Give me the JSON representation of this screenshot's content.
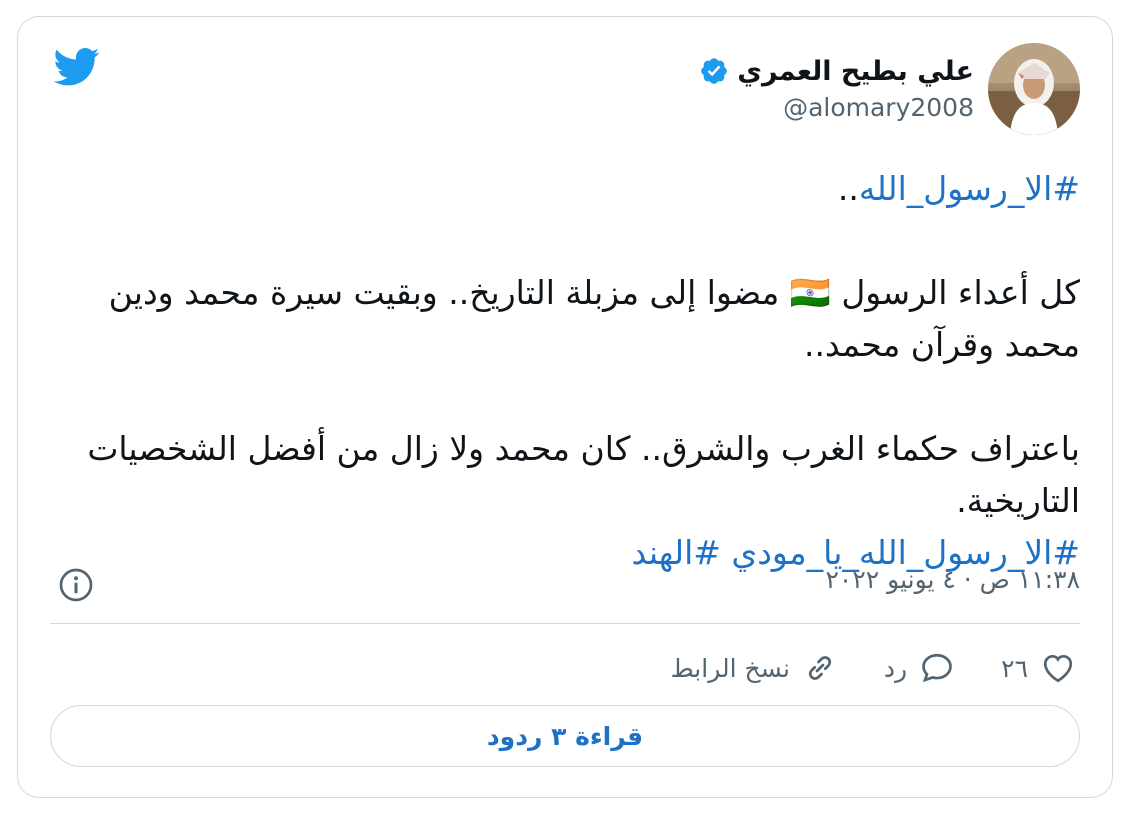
{
  "author": {
    "name": "علي بطيح العمري",
    "handle": "@alomary2008",
    "verified": true
  },
  "tweet": {
    "hashtag_line": "#الا_رسول_الله",
    "hashtag_line_suffix": "..",
    "paragraph_1": "كل أعداء الرسول 🇮🇳 مضوا إلى مزبلة التاريخ.. وبقيت سيرة محمد ودين محمد وقرآن محمد..",
    "paragraph_2": "باعتراف حكماء الغرب والشرق.. كان محمد ولا زال من أفضل الشخصيات التاريخية.",
    "hashtag_1": "#الا_رسول_الله_يا_مودي",
    "hashtag_2": "#الهند"
  },
  "timestamp": "١١:٣٨ ص · ٤ يونيو ٢٠٢٢",
  "actions": {
    "like_count": "٢٦",
    "reply_label": "رد",
    "copy_link_label": "نسخ الرابط"
  },
  "replies_button_label": "قراءة ٣ ردود",
  "colors": {
    "accent": "#1d72c6",
    "twitter_blue": "#1d9bf0",
    "muted_text": "#536471",
    "border": "#cfd9de"
  },
  "icons": [
    "twitter-logo-icon",
    "verified-badge-icon",
    "info-icon",
    "heart-icon",
    "reply-bubble-icon",
    "link-icon"
  ]
}
